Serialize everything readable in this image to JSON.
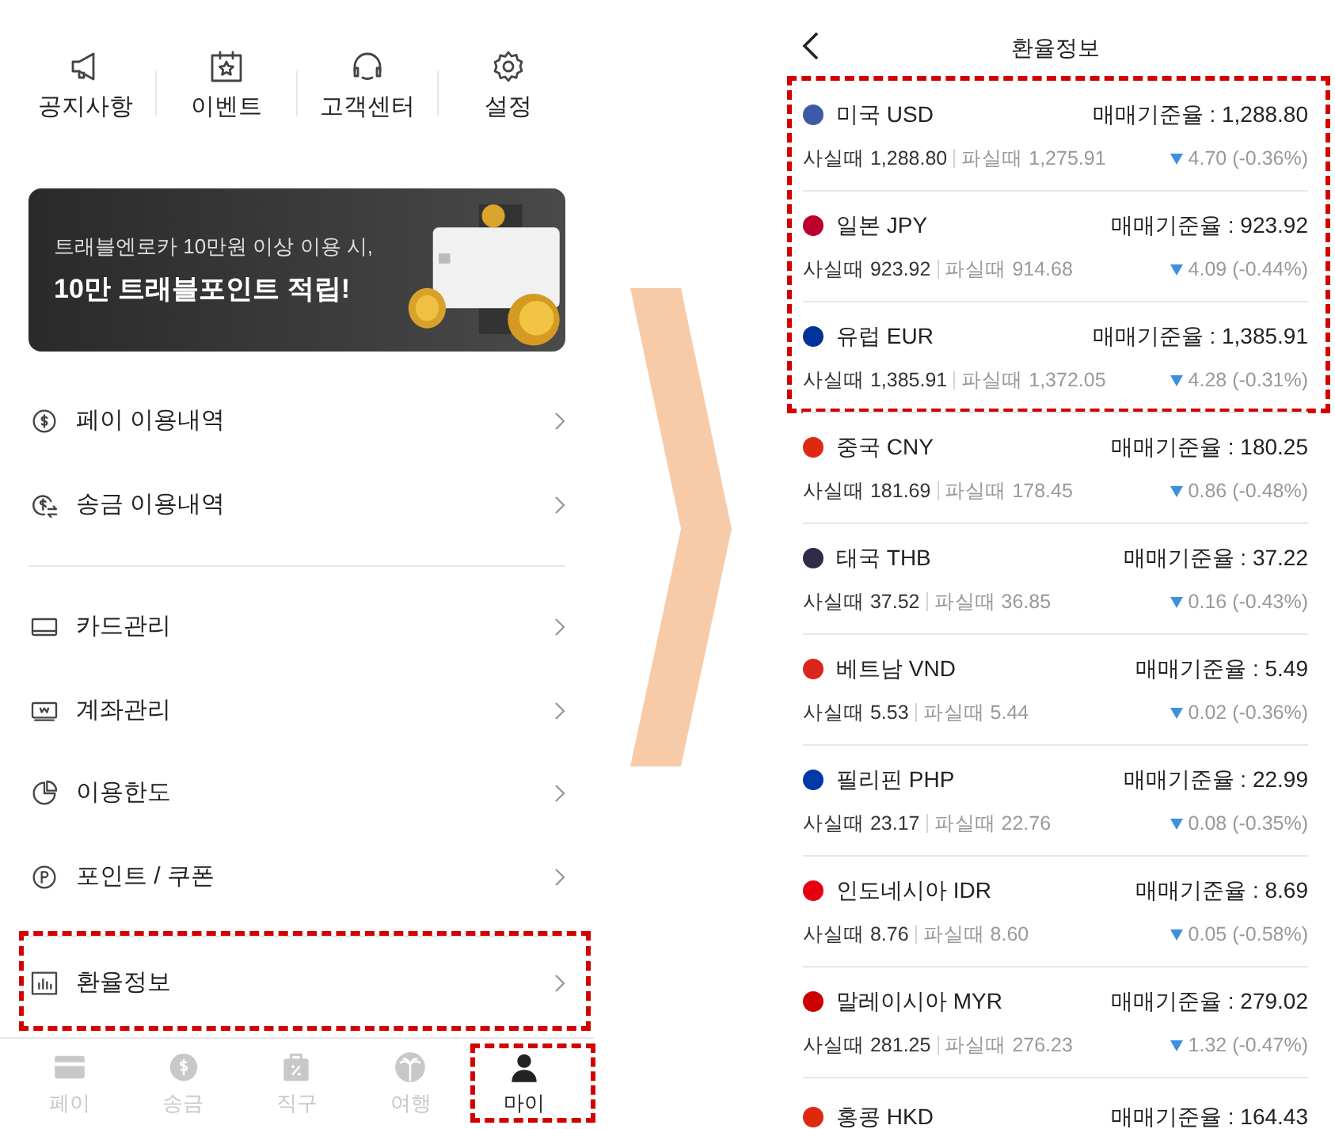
{
  "my_screen": {
    "shortcuts": [
      {
        "kind": "megaphone",
        "label": "공지사항"
      },
      {
        "kind": "calendar",
        "label": "이벤트"
      },
      {
        "kind": "headset",
        "label": "고객센터"
      },
      {
        "kind": "gear",
        "label": "설정"
      }
    ],
    "banner": {
      "line_1": "트래블엔로카 10만원 이상 이용 시,",
      "line_2": "10만 트래블포인트 적립!"
    },
    "menu_groups": [
      [
        {
          "kind": "pay",
          "label": "페이 이용내역",
          "highlighted": false
        },
        {
          "kind": "transfer",
          "label": "송금 이용내역",
          "highlighted": false
        }
      ],
      [
        {
          "kind": "card",
          "label": "카드관리",
          "highlighted": false
        },
        {
          "kind": "account",
          "label": "계좌관리",
          "highlighted": false
        },
        {
          "kind": "limit",
          "label": "이용한도",
          "highlighted": false
        },
        {
          "kind": "point",
          "label": "포인트 / 쿠폰",
          "highlighted": false
        }
      ],
      [
        {
          "kind": "rate",
          "label": "환율정보",
          "highlighted": true
        }
      ]
    ],
    "tabs": [
      {
        "kind": "card",
        "label": "페이",
        "selected": false,
        "highlighted": false
      },
      {
        "kind": "coin",
        "label": "송금",
        "selected": false,
        "highlighted": false
      },
      {
        "kind": "bag",
        "label": "직구",
        "selected": false,
        "highlighted": false
      },
      {
        "kind": "palm",
        "label": "여행",
        "selected": false,
        "highlighted": false
      },
      {
        "kind": "person",
        "label": "마이",
        "selected": true,
        "highlighted": true
      }
    ]
  },
  "rates_screen": {
    "title": "환율정보",
    "rates": [
      {
        "currency": "미국 USD",
        "color": "#3c5aa6",
        "base": "매매기준율 : 1,288.80",
        "buy": "사실때 1,288.80",
        "sell": "파실때 1,275.91",
        "change": "4.70 (-0.36%)",
        "highlighted": true
      },
      {
        "currency": "일본 JPY",
        "color": "#bc002d",
        "base": "매매기준율 : 923.92",
        "buy": "사실때 923.92",
        "sell": "파실때 914.68",
        "change": "4.09 (-0.44%)",
        "highlighted": true
      },
      {
        "currency": "유럽 EUR",
        "color": "#003399",
        "base": "매매기준율 : 1,385.91",
        "buy": "사실때 1,385.91",
        "sell": "파실때 1,372.05",
        "change": "4.28 (-0.31%)",
        "highlighted": true
      },
      {
        "currency": "중국 CNY",
        "color": "#de2910",
        "base": "매매기준율 : 180.25",
        "buy": "사실때 181.69",
        "sell": "파실때 178.45",
        "change": "0.86 (-0.48%)",
        "highlighted": false
      },
      {
        "currency": "태국 THB",
        "color": "#2d2a4a",
        "base": "매매기준율 : 37.22",
        "buy": "사실때 37.52",
        "sell": "파실때 36.85",
        "change": "0.16 (-0.43%)",
        "highlighted": false
      },
      {
        "currency": "베트남 VND",
        "color": "#da251d",
        "base": "매매기준율 : 5.49",
        "buy": "사실때 5.53",
        "sell": "파실때 5.44",
        "change": "0.02 (-0.36%)",
        "highlighted": false
      },
      {
        "currency": "필리핀 PHP",
        "color": "#0038a8",
        "base": "매매기준율 : 22.99",
        "buy": "사실때 23.17",
        "sell": "파실때 22.76",
        "change": "0.08 (-0.35%)",
        "highlighted": false
      },
      {
        "currency": "인도네시아 IDR",
        "color": "#e70011",
        "base": "매매기준율 : 8.69",
        "buy": "사실때 8.76",
        "sell": "파실때 8.60",
        "change": "0.05 (-0.58%)",
        "highlighted": false
      },
      {
        "currency": "말레이시아 MYR",
        "color": "#cc0001",
        "base": "매매기준율 : 279.02",
        "buy": "사실때 281.25",
        "sell": "파실때 276.23",
        "change": "1.32 (-0.47%)",
        "highlighted": false
      },
      {
        "currency": "홍콩 HKD",
        "color": "#de2910",
        "base": "매매기준율 : 164.43",
        "highlighted": false
      }
    ]
  }
}
